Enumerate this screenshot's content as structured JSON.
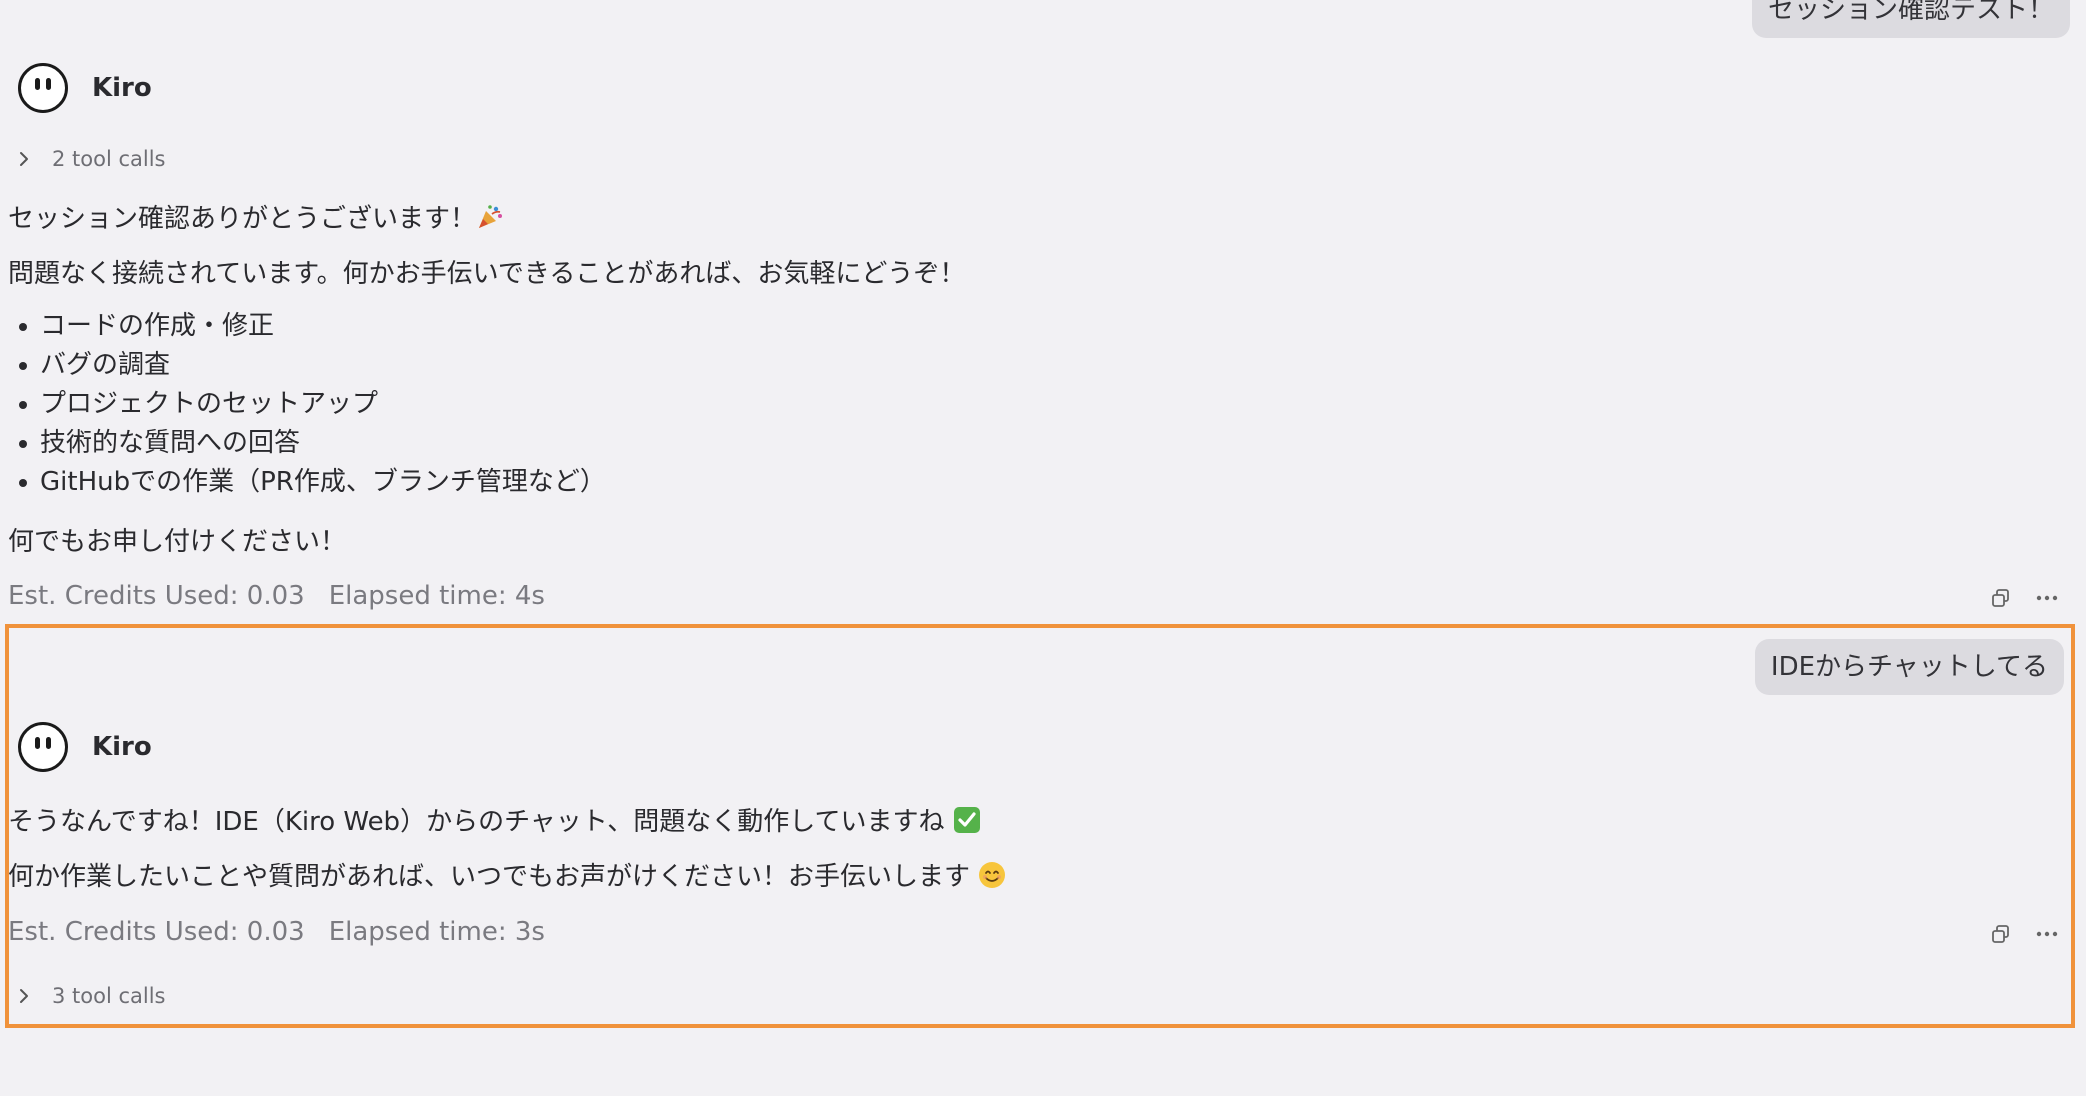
{
  "conversation": {
    "top_user_message": "セッション確認テスト！",
    "first_reply": {
      "sender": "Kiro",
      "tool_calls_label": "2 tool calls",
      "line1": "セッション確認ありがとうございます！",
      "line2": "問題なく接続されています。何かお手伝いできることがあれば、お気軽にどうぞ！",
      "bullets": [
        "コードの作成・修正",
        "バグの調査",
        "プロジェクトのセットアップ",
        "技術的な質問への回答",
        "GitHubでの作業（PR作成、ブランチ管理など）"
      ],
      "closing": "何でもお申し付けください！",
      "credits": "Est. Credits Used: 0.03",
      "elapsed": "Elapsed time: 4s"
    },
    "second_user_message": "IDEからチャットしてる",
    "second_reply": {
      "sender": "Kiro",
      "line1": "そうなんですね！IDE（Kiro Web）からのチャット、問題なく動作していますね",
      "line2": "何か作業したいことや質問があれば、いつでもお声がけください！お手伝いします",
      "credits": "Est. Credits Used: 0.03",
      "elapsed": "Elapsed time: 3s",
      "tool_calls_label": "3 tool calls"
    }
  },
  "icons": {
    "copy": "copy-icon",
    "more": "more-icon",
    "chevron": "chevron-right-icon",
    "party": "party-popper-emoji",
    "check": "check-mark-emoji",
    "smile": "smiling-face-emoji"
  },
  "colors": {
    "background": "#f2f1f4",
    "bubble": "#dcdbe0",
    "highlight_border": "#f0923b",
    "meta_text": "#7a7a80"
  }
}
